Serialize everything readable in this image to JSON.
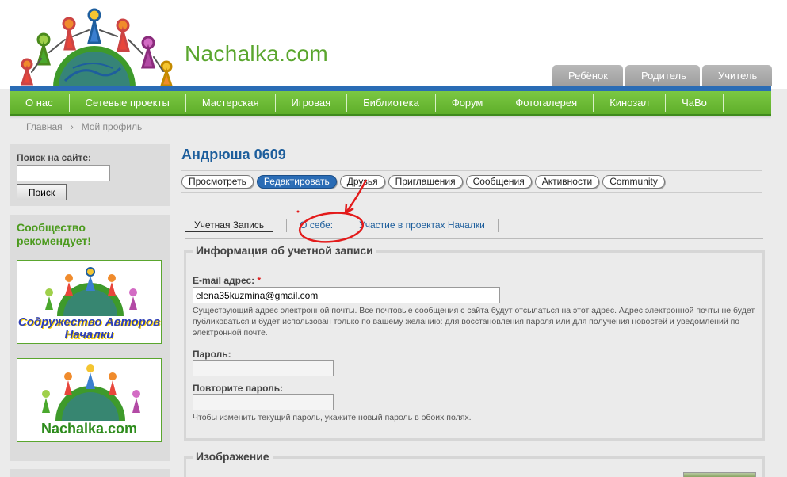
{
  "header": {
    "site_name": "Nachalka.com",
    "role_tabs": [
      "Ребёнок",
      "Родитель",
      "Учитель"
    ]
  },
  "nav": {
    "items": [
      "О нас",
      "Сетевые проекты",
      "Мастерская",
      "Игровая",
      "Библиотека",
      "Форум",
      "Фотогалерея",
      "Кинозал",
      "ЧаВо"
    ]
  },
  "breadcrumb": {
    "home": "Главная",
    "separator": "›",
    "current": "Мой профиль"
  },
  "sidebar": {
    "search_label": "Поиск на сайте:",
    "search_value": "",
    "search_button": "Поиск",
    "community_title": "Сообщество рекомендует!",
    "banner1_text": "Содружество Авторов Началки",
    "banner2_text": "Nachalka.com"
  },
  "main": {
    "title": "Андрюша 0609",
    "primary_tabs": [
      "Просмотреть",
      "Редактировать",
      "Друзья",
      "Приглашения",
      "Сообщения",
      "Активности",
      "Community"
    ],
    "primary_active": "Редактировать",
    "secondary_tabs": [
      "Учетная Запись",
      "О себе:",
      "Участие в проектах Началки"
    ],
    "secondary_active": "Учетная Запись"
  },
  "account": {
    "legend": "Информация об учетной записи",
    "email_label": "E-mail адрес:",
    "required_mark": "*",
    "email_value": "elena35kuzmina@gmail.com",
    "email_desc": "Существующий адрес электронной почты. Все почтовые сообщения с сайта будут отсылаться на этот адрес. Адрес электронной почты не будет публиковаться и будет использован только по вашему желанию: для восстановления пароля или для получения новостей и уведомлений по электронной почте.",
    "password_label": "Пароль:",
    "password_value": "",
    "confirm_label": "Повторите пароль:",
    "confirm_value": "",
    "password_desc": "Чтобы изменить текущий пароль, укажите новый пароль в обоих полях."
  },
  "image_section": {
    "legend": "Изображение"
  },
  "colors": {
    "nav_green": "#5fae2a",
    "brand_blue": "#2a6cb5",
    "title_blue": "#1d5e9c",
    "annotation_red": "#e31b1b"
  }
}
